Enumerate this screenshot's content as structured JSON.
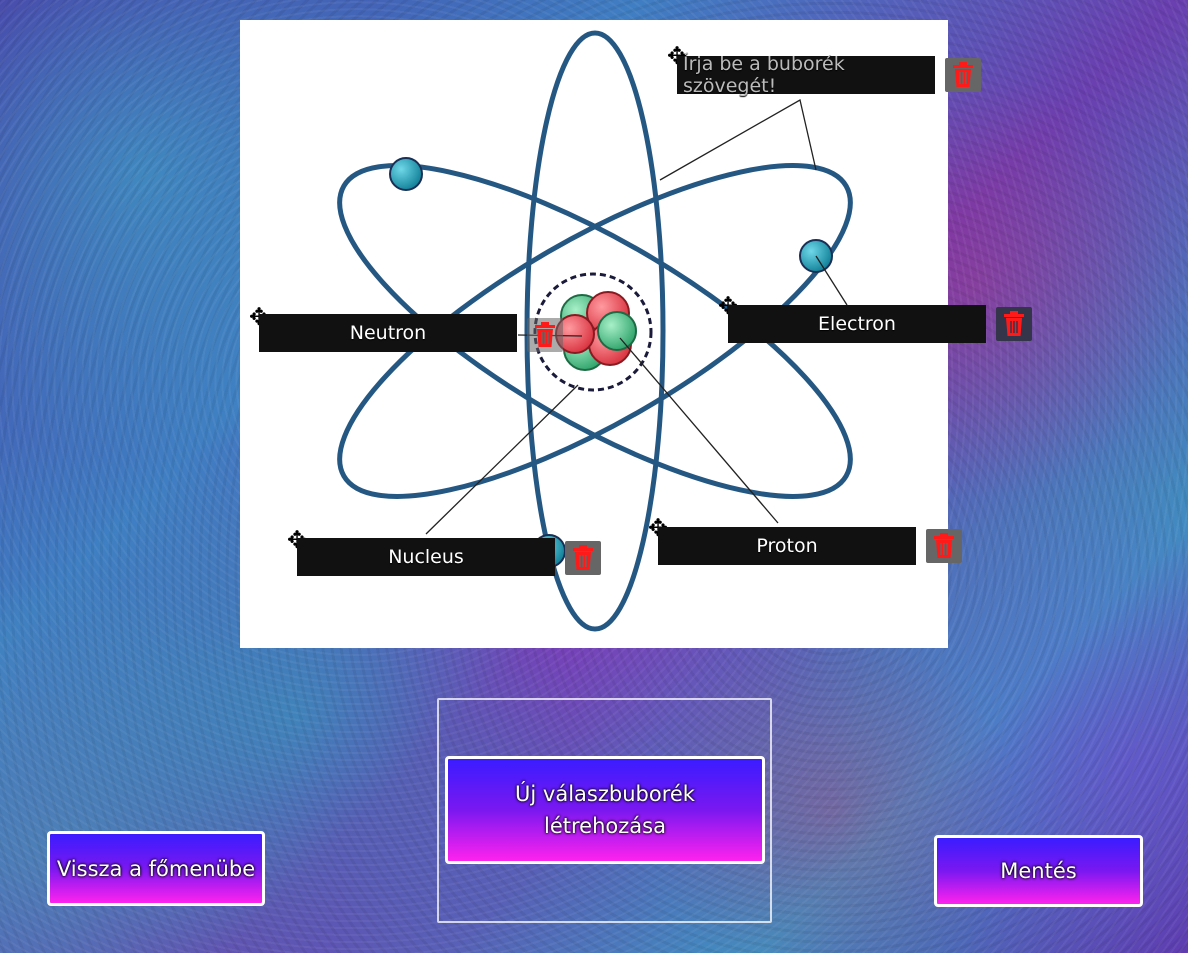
{
  "bubbles": {
    "top": {
      "placeholder": "Írja be a buborék szövegét!"
    },
    "neutron": {
      "label": "Neutron"
    },
    "electron": {
      "label": "Electron"
    },
    "nucleus": {
      "label": "Nucleus"
    },
    "proton": {
      "label": "Proton"
    }
  },
  "buttons": {
    "new_bubble": "Új válaszbuborék létrehozása",
    "back": "Vissza a főmenübe",
    "save": "Mentés"
  },
  "colors": {
    "orbit": "#255783",
    "electron": "#1e97b0",
    "proton": "#e04f58",
    "neutron": "#3bb27a",
    "trash_icon": "#ff1a1a"
  }
}
